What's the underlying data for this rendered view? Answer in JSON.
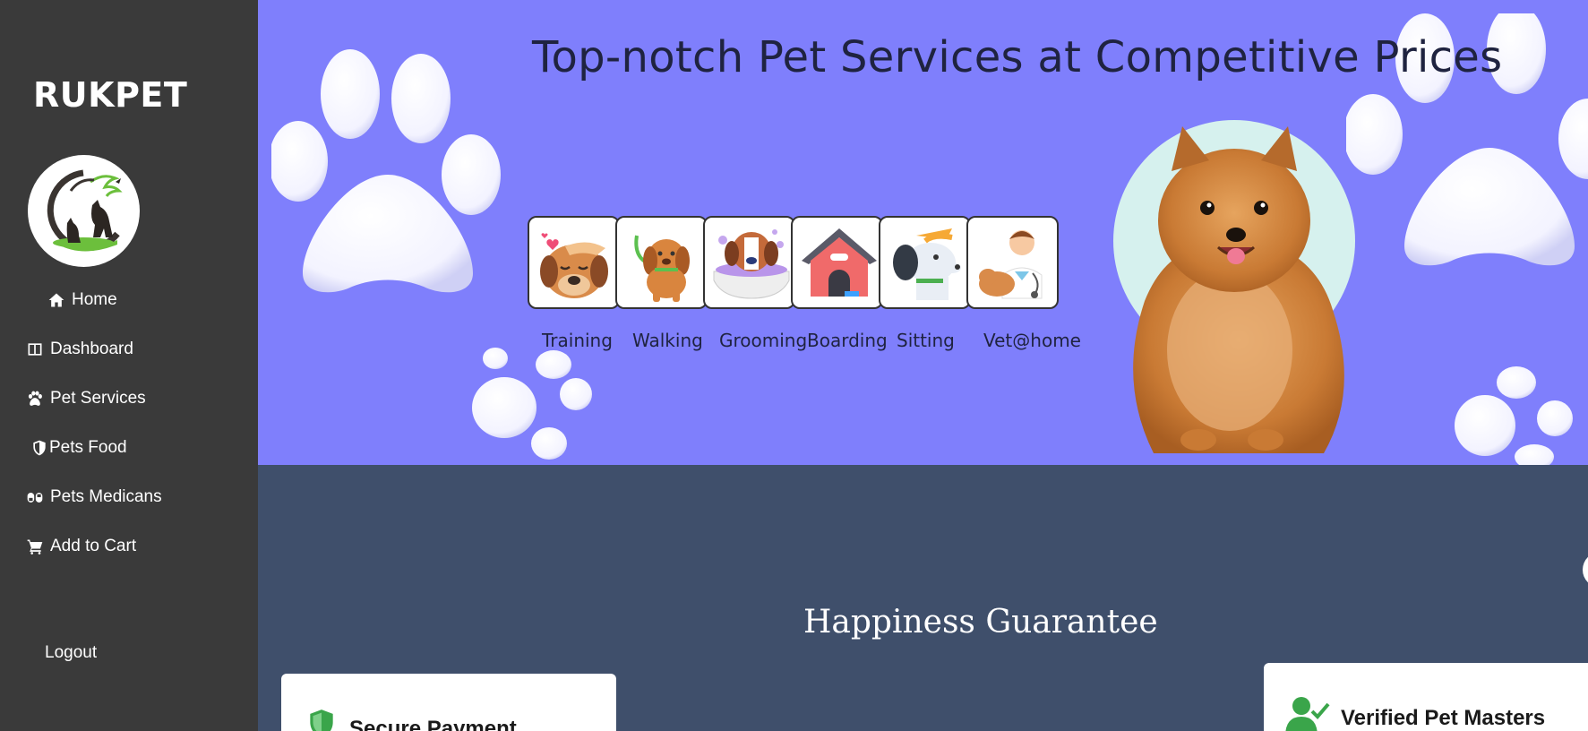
{
  "sidebar": {
    "brand": "RUKPET",
    "nav": [
      {
        "label": "Home",
        "icon": "home-icon"
      },
      {
        "label": "Dashboard",
        "icon": "dashboard-icon"
      },
      {
        "label": "Pet Services",
        "icon": "paw-icon"
      },
      {
        "label": "Pets Food",
        "icon": "shield-icon"
      },
      {
        "label": "Pets Medicans",
        "icon": "pills-icon"
      },
      {
        "label": "Add to Cart",
        "icon": "cart-icon"
      }
    ],
    "logout": "Logout"
  },
  "hero": {
    "title": "Top-notch Pet Services at Competitive Prices",
    "services": [
      {
        "label": "Training",
        "icon": "training-dog-icon"
      },
      {
        "label": "Walking",
        "icon": "walking-dog-icon"
      },
      {
        "label": "Grooming",
        "icon": "grooming-dog-icon"
      },
      {
        "label": "Boarding",
        "icon": "dog-house-icon"
      },
      {
        "label": "Sitting",
        "icon": "sitting-dog-icon"
      },
      {
        "label": "Vet@home",
        "icon": "vet-icon"
      }
    ]
  },
  "guarantee": {
    "title": "Happiness Guarantee",
    "cards": [
      {
        "title": "Secure Payment",
        "icon": "shield-icon"
      },
      {
        "title": "Verified Pet Masters",
        "icon": "verified-user-icon"
      }
    ]
  },
  "colors": {
    "sidebar": "#3a3a3a",
    "hero": "#7f7ffc",
    "section": "#3f4f6b"
  }
}
